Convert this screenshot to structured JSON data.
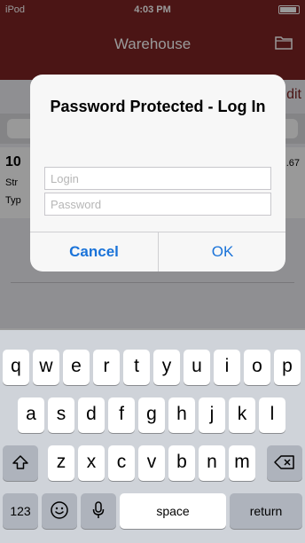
{
  "status_bar": {
    "carrier": "iPod",
    "time": "4:03 PM"
  },
  "nav": {
    "title": "Warehouse",
    "folder_icon": "folder-icon"
  },
  "background": {
    "edit_label": "dit",
    "row": {
      "number": "10",
      "line1": "Str",
      "line2": "Typ",
      "right_value": ".67"
    }
  },
  "dialog": {
    "title": "Password Protected - Log In",
    "login_placeholder": "Login",
    "password_placeholder": "Password",
    "cancel_label": "Cancel",
    "ok_label": "OK"
  },
  "keyboard": {
    "row1": [
      "q",
      "w",
      "e",
      "r",
      "t",
      "y",
      "u",
      "i",
      "o",
      "p"
    ],
    "row2": [
      "a",
      "s",
      "d",
      "f",
      "g",
      "h",
      "j",
      "k",
      "l"
    ],
    "row3": [
      "z",
      "x",
      "c",
      "v",
      "b",
      "n",
      "m"
    ],
    "numbers_label": "123",
    "space_label": "space",
    "return_label": "return",
    "icons": [
      "shift-icon",
      "backspace-icon",
      "emoji-icon",
      "microphone-icon"
    ]
  },
  "colors": {
    "nav_background": "#7d2424",
    "accent_blue": "#1a73d9"
  }
}
